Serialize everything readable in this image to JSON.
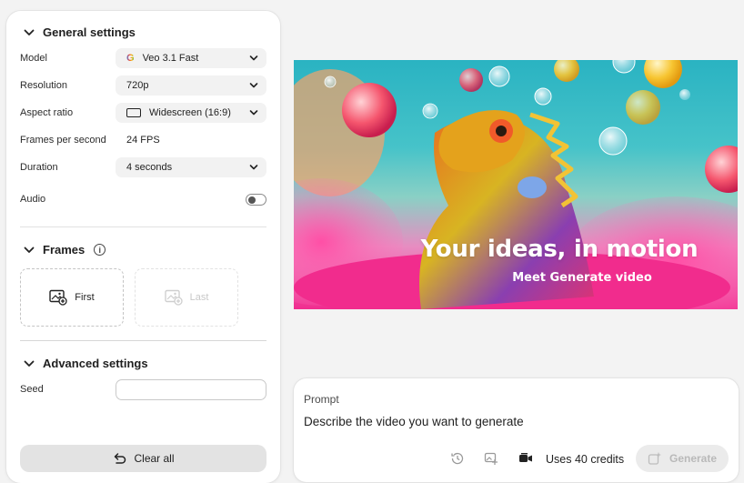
{
  "general": {
    "heading": "General settings",
    "model_label": "Model",
    "model_value": "Veo 3.1 Fast",
    "model_logo": "G",
    "resolution_label": "Resolution",
    "resolution_value": "720p",
    "aspect_label": "Aspect ratio",
    "aspect_value": "Widescreen (16:9)",
    "fps_label": "Frames per second",
    "fps_value": "24 FPS",
    "duration_label": "Duration",
    "duration_value": "4 seconds",
    "audio_label": "Audio",
    "audio_on": false
  },
  "frames": {
    "heading": "Frames",
    "first_label": "First",
    "last_label": "Last"
  },
  "advanced": {
    "heading": "Advanced settings",
    "seed_label": "Seed",
    "seed_value": ""
  },
  "clear_label": "Clear all",
  "hero": {
    "title": "Your ideas, in motion",
    "subtitle": "Meet Generate video"
  },
  "prompt": {
    "label": "Prompt",
    "placeholder": "Describe the video you want to generate",
    "credits": "Uses 40 credits",
    "generate_label": "Generate"
  },
  "colors": {
    "panel_bg": "#ffffff",
    "page_bg": "#f3f3f3",
    "control_bg": "#f2f2f2",
    "disabled_text": "#b9b9b9"
  }
}
